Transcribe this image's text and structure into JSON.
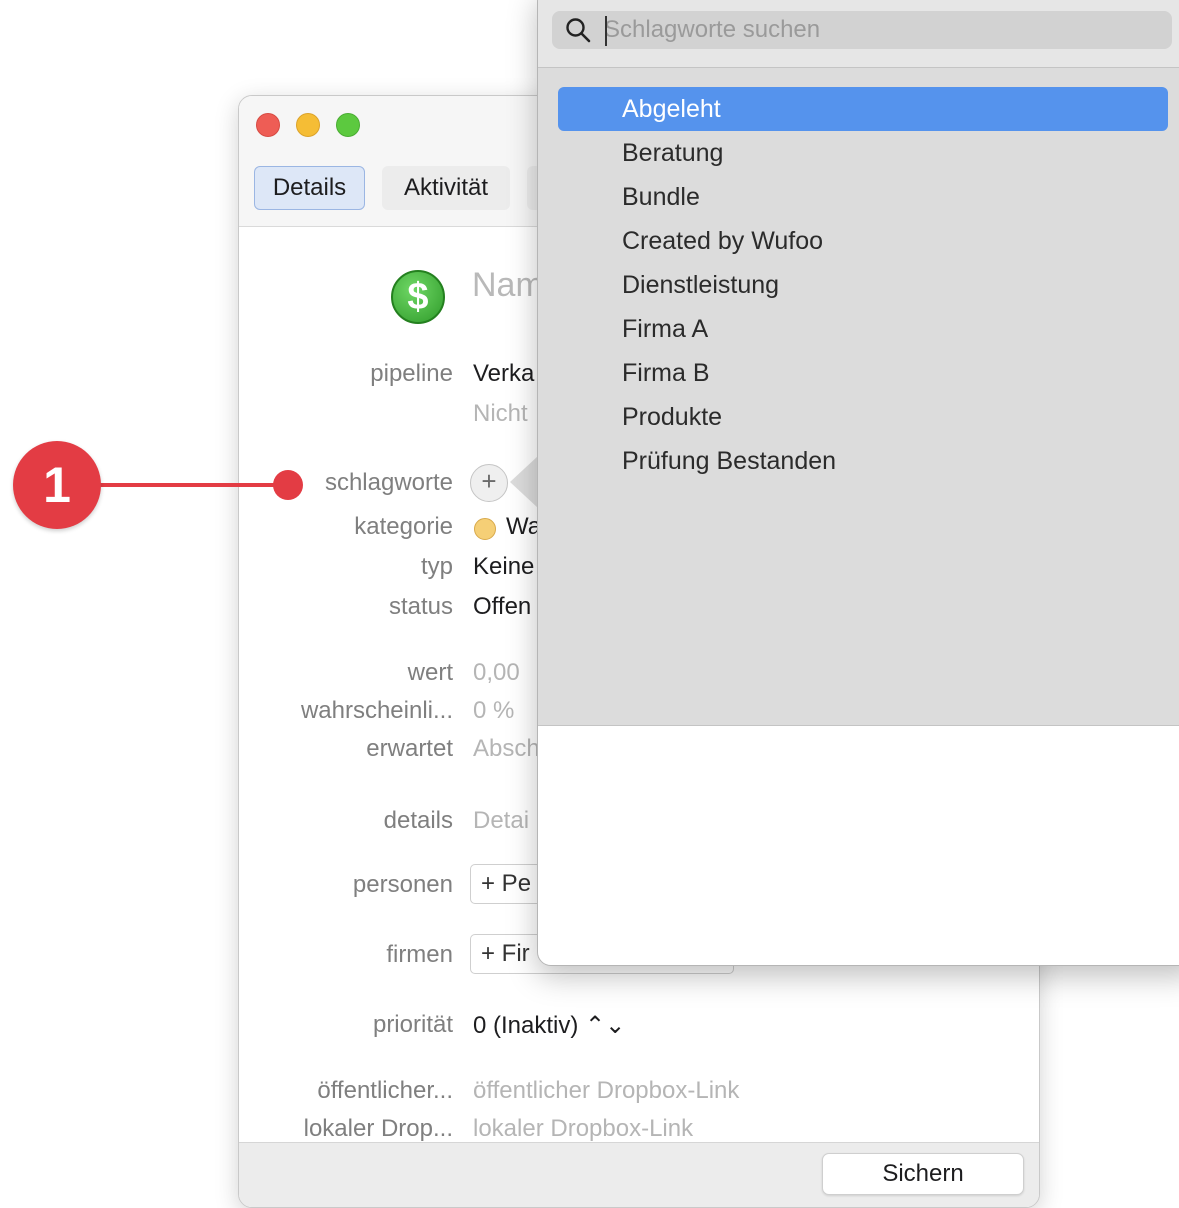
{
  "window": {
    "tabs": [
      "Details",
      "Aktivität",
      ""
    ],
    "deal_icon": "dollar-icon",
    "name_placeholder": "Nam",
    "fields": {
      "pipeline_label": "pipeline",
      "pipeline_value": "Verka",
      "pipeline_stage": "Nicht",
      "tags_label": "schlagworte",
      "tags_add": "+",
      "category_label": "kategorie",
      "category_value": "Wa",
      "type_label": "typ",
      "type_value": "Keine",
      "status_label": "status",
      "status_value": "Offen",
      "value_label": "wert",
      "value_value": "0,00 ",
      "probability_label": "wahrscheinli...",
      "probability_value": "0 %",
      "expected_label": "erwartet",
      "expected_value": "Absch",
      "details_label": "details",
      "details_value": "Detai",
      "persons_label": "personen",
      "persons_button": "+ Pe",
      "companies_label": "firmen",
      "companies_button": "+ Fir",
      "priority_label": "priorität",
      "priority_value": "0 (Inaktiv) ⌃⌄",
      "public_dropbox_label": "öffentlicher...",
      "public_dropbox_value": "öffentlicher Dropbox-Link",
      "local_dropbox_label": "lokaler Drop...",
      "local_dropbox_value": "lokaler Dropbox-Link"
    },
    "save_label": "Sichern"
  },
  "popover": {
    "search_placeholder": "Schlagworte suchen",
    "search_value": "",
    "items": [
      "Abgeleht",
      "Beratung",
      "Bundle",
      "Created by Wufoo",
      "Dienstleistung",
      "Firma A",
      "Firma B",
      "Produkte",
      "Prüfung Bestanden"
    ],
    "selected_index": 0
  },
  "callout": {
    "number": "1"
  },
  "colors": {
    "selection": "#5593ed",
    "callout": "#e33c44",
    "category_dot": "#f5cf76"
  }
}
